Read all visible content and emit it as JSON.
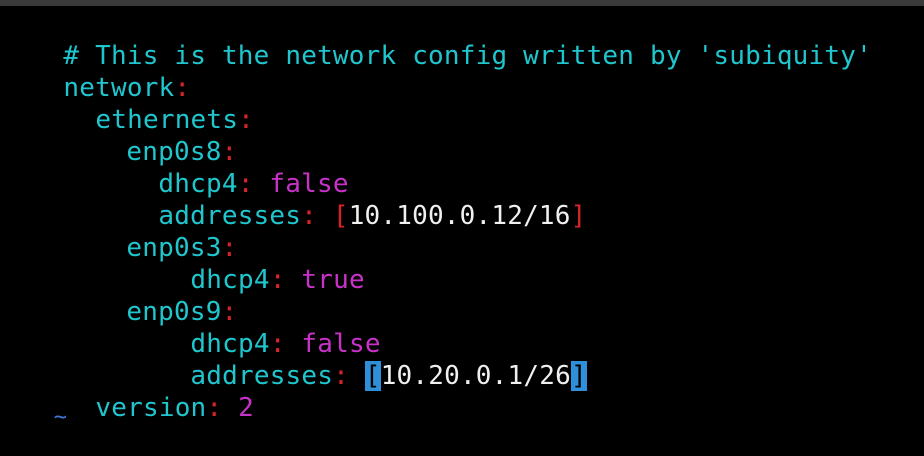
{
  "editor": {
    "comment": "# This is the network config written by 'subiquity'",
    "network_key": "network",
    "ethernets_key": "ethernets",
    "colon": ":",
    "interfaces": [
      {
        "name": "enp0s8",
        "dhcp4_key": "dhcp4",
        "dhcp4_value": "false",
        "addresses_key": "addresses",
        "open_bracket": "[",
        "address": "10.100.0.12/16",
        "close_bracket": "]"
      },
      {
        "name": "enp0s3",
        "dhcp4_key": "dhcp4",
        "dhcp4_value": "true"
      },
      {
        "name": "enp0s9",
        "dhcp4_key": "dhcp4",
        "dhcp4_value": "false",
        "addresses_key": "addresses",
        "open_bracket": "[",
        "address": "10.20.0.1/26",
        "close_bracket": "]"
      }
    ],
    "version_key": "version",
    "version_value": "2",
    "tilde": "~"
  },
  "colors": {
    "background": "#000000",
    "key": "#1fc6ce",
    "colon": "#d6242a",
    "value": "#c832c8",
    "text": "#f0f0f0",
    "bracket_highlight": "#2f8fd8",
    "tilde": "#3e7bd6"
  }
}
